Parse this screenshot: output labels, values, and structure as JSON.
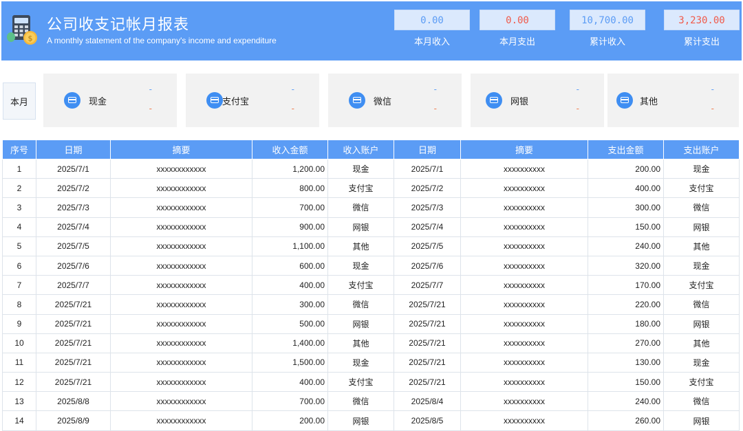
{
  "header": {
    "title": "公司收支记帐月报表",
    "subtitle": "A monthly statement of the company's income and expenditure",
    "stats": [
      {
        "value": "0.00",
        "label": "本月收入"
      },
      {
        "value": "0.00",
        "label": "本月支出"
      },
      {
        "value": "10,700.00",
        "label": "累计收入"
      },
      {
        "value": "3,230.00",
        "label": "累计支出"
      }
    ]
  },
  "accounts": {
    "month_label": "本月",
    "items": [
      {
        "name": "现金",
        "income": "-",
        "expense": "-"
      },
      {
        "name": "支付宝",
        "income": "-",
        "expense": "-"
      },
      {
        "name": "微信",
        "income": "-",
        "expense": "-"
      },
      {
        "name": "网银",
        "income": "-",
        "expense": "-"
      },
      {
        "name": "其他",
        "income": "-",
        "expense": "-"
      }
    ]
  },
  "table": {
    "headers": [
      "序号",
      "日期",
      "摘要",
      "收入金额",
      "收入账户",
      "日期",
      "摘要",
      "支出金额",
      "支出账户"
    ],
    "rows": [
      [
        "1",
        "2025/7/1",
        "xxxxxxxxxxxx",
        "1,200.00",
        "现金",
        "2025/7/1",
        "xxxxxxxxxx",
        "200.00",
        "现金"
      ],
      [
        "2",
        "2025/7/2",
        "xxxxxxxxxxxx",
        "800.00",
        "支付宝",
        "2025/7/2",
        "xxxxxxxxxx",
        "400.00",
        "支付宝"
      ],
      [
        "3",
        "2025/7/3",
        "xxxxxxxxxxxx",
        "700.00",
        "微信",
        "2025/7/3",
        "xxxxxxxxxx",
        "300.00",
        "微信"
      ],
      [
        "4",
        "2025/7/4",
        "xxxxxxxxxxxx",
        "900.00",
        "网银",
        "2025/7/4",
        "xxxxxxxxxx",
        "150.00",
        "网银"
      ],
      [
        "5",
        "2025/7/5",
        "xxxxxxxxxxxx",
        "1,100.00",
        "其他",
        "2025/7/5",
        "xxxxxxxxxx",
        "240.00",
        "其他"
      ],
      [
        "6",
        "2025/7/6",
        "xxxxxxxxxxxx",
        "600.00",
        "现金",
        "2025/7/6",
        "xxxxxxxxxx",
        "320.00",
        "现金"
      ],
      [
        "7",
        "2025/7/7",
        "xxxxxxxxxxxx",
        "400.00",
        "支付宝",
        "2025/7/7",
        "xxxxxxxxxx",
        "170.00",
        "支付宝"
      ],
      [
        "8",
        "2025/7/21",
        "xxxxxxxxxxxx",
        "300.00",
        "微信",
        "2025/7/21",
        "xxxxxxxxxx",
        "220.00",
        "微信"
      ],
      [
        "9",
        "2025/7/21",
        "xxxxxxxxxxxx",
        "500.00",
        "网银",
        "2025/7/21",
        "xxxxxxxxxx",
        "180.00",
        "网银"
      ],
      [
        "10",
        "2025/7/21",
        "xxxxxxxxxxxx",
        "1,400.00",
        "其他",
        "2025/7/21",
        "xxxxxxxxxx",
        "270.00",
        "其他"
      ],
      [
        "11",
        "2025/7/21",
        "xxxxxxxxxxxx",
        "1,500.00",
        "现金",
        "2025/7/21",
        "xxxxxxxxxx",
        "130.00",
        "现金"
      ],
      [
        "12",
        "2025/7/21",
        "xxxxxxxxxxxx",
        "400.00",
        "支付宝",
        "2025/7/21",
        "xxxxxxxxxx",
        "150.00",
        "支付宝"
      ],
      [
        "13",
        "2025/8/8",
        "xxxxxxxxxxxx",
        "700.00",
        "微信",
        "2025/8/4",
        "xxxxxxxxxx",
        "240.00",
        "微信"
      ],
      [
        "14",
        "2025/8/9",
        "xxxxxxxxxxxx",
        "200.00",
        "网银",
        "2025/8/5",
        "xxxxxxxxxx",
        "260.00",
        "网银"
      ]
    ]
  },
  "colors": {
    "header_bg": "#5b9cf5",
    "income": "#5b9cf5",
    "expense": "#f05a4a"
  }
}
